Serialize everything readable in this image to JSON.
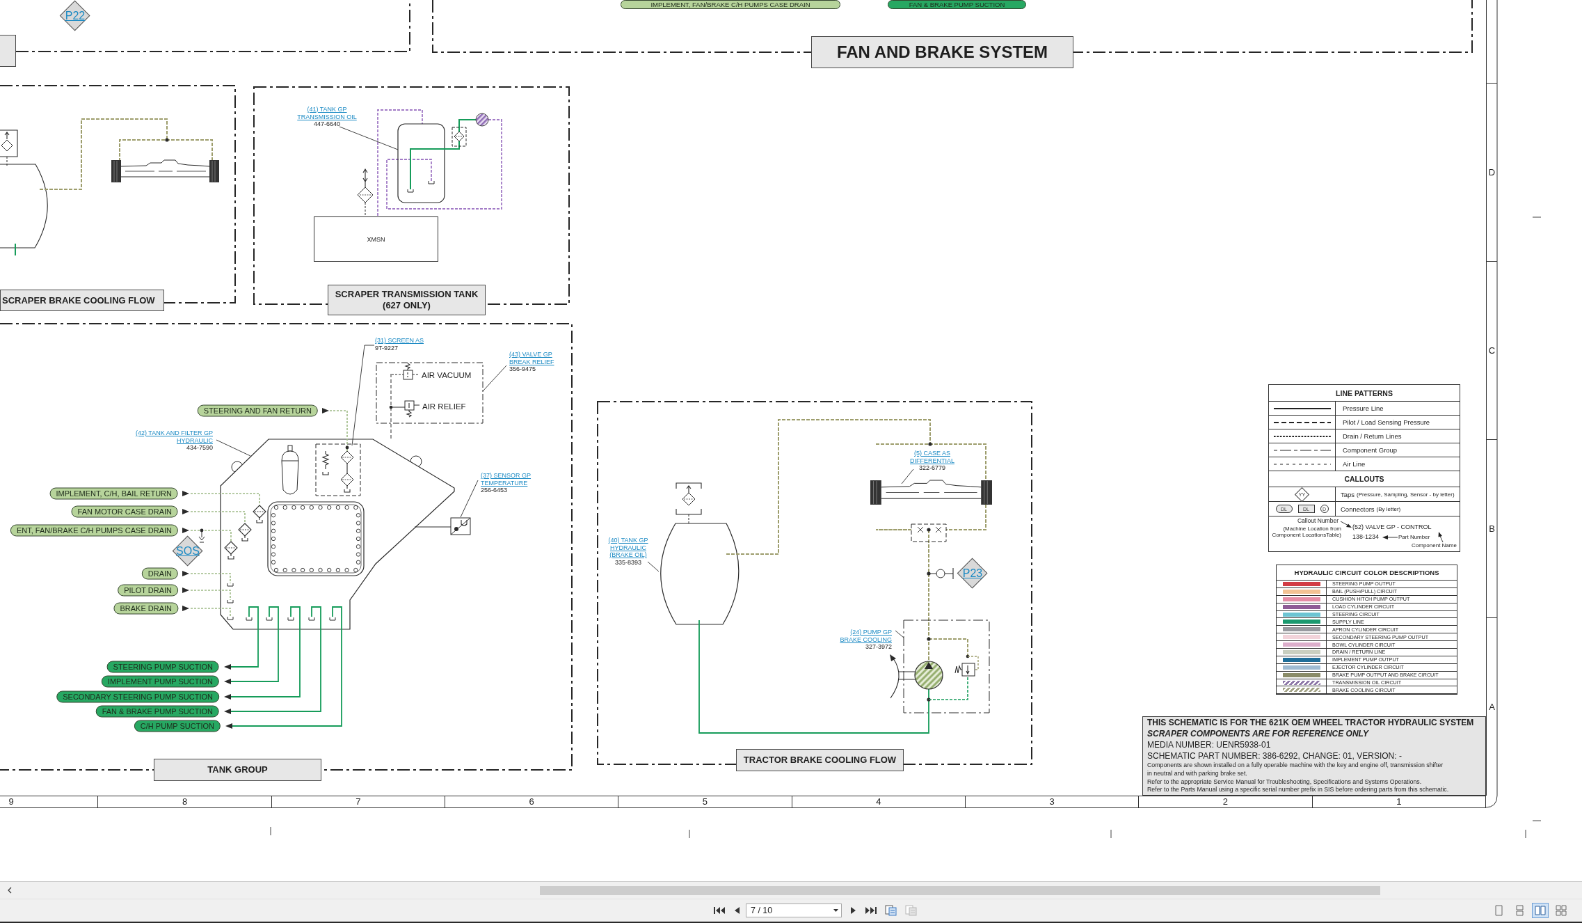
{
  "sheet": {
    "top_labels": [
      {
        "text": "IMPLEMENT, FAN/BRAKE C/H PUMPS CASE DRAIN",
        "kind": "return"
      },
      {
        "text": "FAN & BRAKE PUMP SUCTION",
        "kind": "suction"
      }
    ],
    "top_tap": "P22",
    "system_title": "FAN AND BRAKE SYSTEM",
    "scraper_brake_cooling": {
      "title": "SCRAPER BRAKE COOLING FLOW"
    },
    "scraper_transmission_tank": {
      "title": [
        "SCRAPER TRANSMISSION TANK",
        "(627 ONLY)"
      ],
      "callout": {
        "name": [
          "(41) TANK GP",
          "TRANSMISSION OIL"
        ],
        "part": "447-6640"
      },
      "component": "XMSN"
    },
    "tank_group": {
      "title": "TANK GROUP",
      "line_labels": [
        {
          "text": "STEERING AND FAN RETURN",
          "kind": "return"
        },
        {
          "text": "IMPLEMENT, C/H, BAIL RETURN",
          "kind": "return"
        },
        {
          "text": "FAN MOTOR CASE DRAIN",
          "kind": "return"
        },
        {
          "text": "ENT, FAN/BRAKE C/H PUMPS CASE DRAIN",
          "kind": "return"
        },
        {
          "text": "DRAIN",
          "kind": "return"
        },
        {
          "text": "PILOT DRAIN",
          "kind": "return"
        },
        {
          "text": "BRAKE DRAIN",
          "kind": "return"
        },
        {
          "text": "STEERING PUMP SUCTION",
          "kind": "suction"
        },
        {
          "text": "IMPLEMENT PUMP SUCTION",
          "kind": "suction"
        },
        {
          "text": "SECONDARY STEERING PUMP SUCTION",
          "kind": "suction"
        },
        {
          "text": "FAN & BRAKE PUMP SUCTION",
          "kind": "suction"
        },
        {
          "text": "C/H PUMP SUCTION",
          "kind": "suction"
        }
      ],
      "callouts": [
        {
          "name": [
            "(31) SCREEN AS"
          ],
          "part": "9T-9227"
        },
        {
          "name": [
            "(43) VALVE GP",
            "BREAK RELIEF"
          ],
          "part": "356-9475"
        },
        {
          "name": [
            "(42) TANK AND FILTER GP",
            "HYDRAULIC"
          ],
          "part": "434-7590"
        },
        {
          "name": [
            "(37) SENSOR GP",
            "TEMPERATURE"
          ],
          "part": "256-6453"
        }
      ],
      "valve_labels": [
        "AIR VACUUM",
        "AIR RELIEF"
      ],
      "tap": "SOS"
    },
    "tractor_brake_cooling": {
      "title": "TRACTOR BRAKE COOLING FLOW",
      "callouts": [
        {
          "name": [
            "(5) CASE AS",
            "DIFFERENTIAL"
          ],
          "part": "322-6779"
        },
        {
          "name": [
            "(40) TANK GP",
            "HYDRAULIC",
            "(BRAKE OIL)"
          ],
          "part": "335-8393"
        },
        {
          "name": [
            "(24) PUMP GP",
            "BRAKE COOLING"
          ],
          "part": "327-3972"
        }
      ],
      "tap": "P23"
    },
    "legend": {
      "line_patterns": {
        "title": "LINE PATTERNS",
        "rows": [
          {
            "kind": "solid",
            "label": "Pressure Line"
          },
          {
            "kind": "dashed",
            "label": "Pilot / Load Sensing Pressure"
          },
          {
            "kind": "dotted",
            "label": "Drain / Return Lines"
          },
          {
            "kind": "dash_dot",
            "label": "Component Group"
          },
          {
            "kind": "fine_dashed",
            "label": "Air Line"
          }
        ]
      },
      "callouts": {
        "title": "CALLOUTS",
        "rows": [
          {
            "label": "Taps",
            "note": "(Pressure, Sampling, Sensor - by letter)",
            "symbols": [
              {
                "kind": "diamond",
                "text": "YY"
              }
            ]
          },
          {
            "label": "Connectors",
            "note": "(By letter)",
            "symbols": [
              {
                "kind": "oval",
                "text": "DL"
              },
              {
                "kind": "box",
                "text": "DL"
              },
              {
                "kind": "circle",
                "text": "D"
              }
            ]
          }
        ],
        "example": {
          "callout_number": "Callout Number",
          "callout_note": "(Machine Location from Component LocationsTable)",
          "component": "(52) VALVE GP - CONTROL",
          "component_name": "Component Name",
          "part": "138-1234",
          "part_label": "Part Number"
        }
      },
      "color_descriptions": {
        "title": "HYDRAULIC CIRCUIT COLOR DESCRIPTIONS",
        "rows": [
          {
            "label": "STEERING PUMP OUTPUT",
            "color": "#d23c45",
            "kind": "solid"
          },
          {
            "label": "BAIL (PUSH/PULL) CIRCUIT",
            "color": "#f3c294",
            "kind": "solid"
          },
          {
            "label": "CUSHION HITCH PUMP OUTPUT",
            "color": "#e58da6",
            "kind": "solid"
          },
          {
            "label": "LOAD CYLINDER CIRCUIT",
            "color": "#8e5b96",
            "kind": "solid"
          },
          {
            "label": "STEERING CIRCUIT",
            "color": "#6cc4d2",
            "kind": "solid"
          },
          {
            "label": "SUPPLY LINE",
            "color": "#1c9a70",
            "kind": "solid"
          },
          {
            "label": "APRON CYLINDER CIRCUIT",
            "color": "#999aa0",
            "kind": "solid"
          },
          {
            "label": "SECONDARY STEERING PUMP OUTPUT",
            "color": "#f2d3da",
            "kind": "solid"
          },
          {
            "label": "BOWL CYLINDER CIRCUIT",
            "color": "#dcaecb",
            "kind": "solid"
          },
          {
            "label": "DRAIN / RETURN LINE",
            "color": "#c9cfc0",
            "kind": "solid"
          },
          {
            "label": "IMPLEMENT PUMP OUTPUT",
            "color": "#1f6f9a",
            "kind": "solid"
          },
          {
            "label": "EJECTOR CYLINDER CIRCUIT",
            "color": "#9fbcd3",
            "kind": "solid"
          },
          {
            "label": "BRAKE PUMP OUTPUT AND BRAKE CIRCUIT",
            "color": "#8b8c68",
            "kind": "solid"
          },
          {
            "label": "TRANSMISSION OIL CIRCUIT",
            "color": "#8e78a8",
            "kind": "hatched"
          },
          {
            "label": "BRAKE COOLING CIRCUIT",
            "color": "#a4a487",
            "kind": "hatched"
          }
        ]
      }
    },
    "title_block": [
      {
        "kind": "heading",
        "text": "THIS SCHEMATIC IS FOR THE 621K OEM WHEEL TRACTOR HYDRAULIC SYSTEM"
      },
      {
        "kind": "emphasis",
        "text": "SCRAPER COMPONENTS ARE FOR REFERENCE ONLY"
      },
      {
        "kind": "info",
        "text": "MEDIA NUMBER: UENR5938-01"
      },
      {
        "kind": "info_last",
        "text": "SCHEMATIC PART NUMBER: 386-6292, CHANGE: 01, VERSION: -"
      },
      {
        "kind": "note_wrapped",
        "text": "Components are shown installed on a fully operable machine with the key and engine off, transmission shifter in neutral and with parking brake set."
      },
      {
        "kind": "note",
        "text": "Refer to the appropriate Service Manual for Troubleshooting, Specifications and Systems Operations."
      },
      {
        "kind": "note",
        "text": "Refer to the Parts Manual using a specific serial number prefix in SIS before ordering parts from this schematic."
      }
    ],
    "zones": {
      "rows": [
        "D",
        "C",
        "B",
        "A"
      ],
      "columns": [
        "9",
        "8",
        "7",
        "6",
        "5",
        "4",
        "3",
        "2",
        "1"
      ]
    }
  },
  "viewer": {
    "page": "7 / 10",
    "page_tools": [
      {
        "disabled": false
      },
      {
        "disabled": true
      }
    ],
    "view_modes": [
      {
        "selected": false
      },
      {
        "selected": false
      },
      {
        "selected": true
      },
      {
        "selected": false
      }
    ]
  }
}
